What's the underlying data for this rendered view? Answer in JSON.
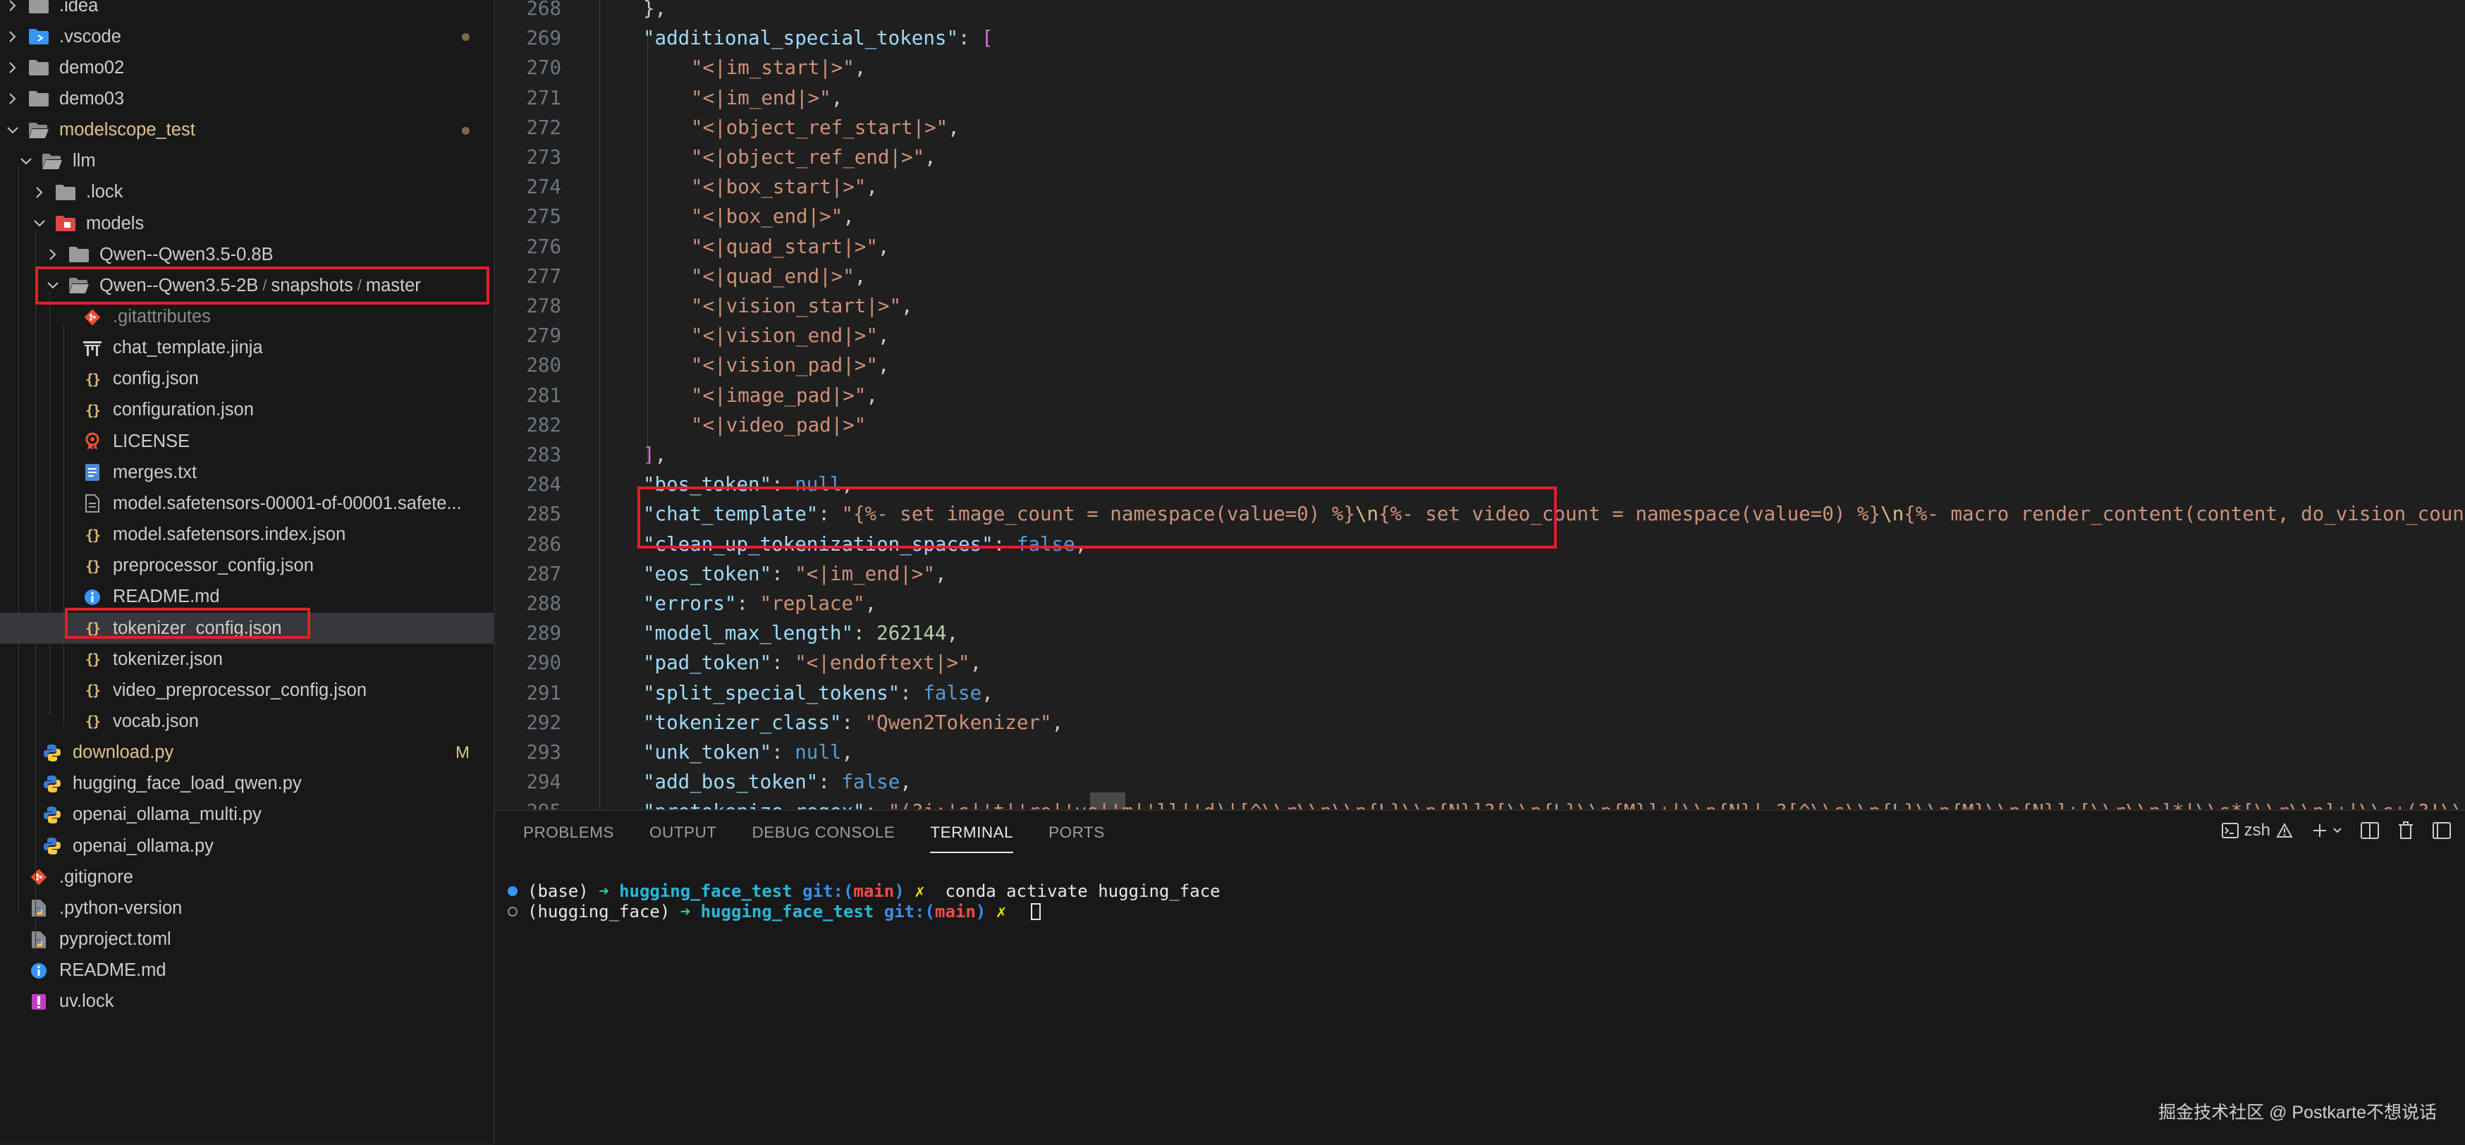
{
  "colors": {
    "background": "#1f1f1f",
    "sidebar_bg": "#181818",
    "highlight_red": "#e0202a",
    "modified_yellow": "#e2c08d",
    "json_key": "#9cdcfe",
    "json_string": "#ce9178"
  },
  "explorer": {
    "items": [
      {
        "label": ".idea",
        "icon": "folder-idea-icon",
        "depth": 0,
        "chevron": "right"
      },
      {
        "label": ".vscode",
        "icon": "folder-vscode-icon",
        "depth": 0,
        "chevron": "right",
        "status": "dot"
      },
      {
        "label": "demo02",
        "icon": "folder-icon",
        "depth": 0,
        "chevron": "right"
      },
      {
        "label": "demo03",
        "icon": "folder-icon",
        "depth": 0,
        "chevron": "right"
      },
      {
        "label": "modelscope_test",
        "icon": "folder-open-icon",
        "depth": 0,
        "chevron": "down",
        "status": "dot",
        "modified": true
      },
      {
        "label": "llm",
        "icon": "folder-open-icon",
        "depth": 1,
        "chevron": "down"
      },
      {
        "label": ".lock",
        "icon": "folder-icon",
        "depth": 2,
        "chevron": "right"
      },
      {
        "label": "models",
        "icon": "folder-models-icon",
        "depth": 2,
        "chevron": "down"
      },
      {
        "label": "Qwen--Qwen3.5-0.8B",
        "icon": "folder-icon",
        "depth": 3,
        "chevron": "right"
      },
      {
        "label": "Qwen--Qwen3.5-2B",
        "path_parts": [
          "snapshots",
          "master"
        ],
        "icon": "folder-open-icon",
        "depth": 3,
        "chevron": "down"
      },
      {
        "label": ".gitattributes",
        "icon": "git-icon",
        "depth": 4,
        "dim": true
      },
      {
        "label": "chat_template.jinja",
        "icon": "jinja-icon",
        "depth": 4
      },
      {
        "label": "config.json",
        "icon": "json-icon",
        "depth": 4
      },
      {
        "label": "configuration.json",
        "icon": "json-icon",
        "depth": 4
      },
      {
        "label": "LICENSE",
        "icon": "license-icon",
        "depth": 4
      },
      {
        "label": "merges.txt",
        "icon": "text-file-icon",
        "depth": 4
      },
      {
        "label": "model.safetensors-00001-of-00001.safete...",
        "icon": "file-icon",
        "depth": 4
      },
      {
        "label": "model.safetensors.index.json",
        "icon": "json-icon",
        "depth": 4
      },
      {
        "label": "preprocessor_config.json",
        "icon": "json-icon",
        "depth": 4
      },
      {
        "label": "README.md",
        "icon": "info-icon",
        "depth": 4
      },
      {
        "label": "tokenizer_config.json",
        "icon": "json-icon",
        "depth": 4,
        "selected": true
      },
      {
        "label": "tokenizer.json",
        "icon": "json-icon",
        "depth": 4
      },
      {
        "label": "video_preprocessor_config.json",
        "icon": "json-icon",
        "depth": 4
      },
      {
        "label": "vocab.json",
        "icon": "json-icon",
        "depth": 4
      },
      {
        "label": "download.py",
        "icon": "python-icon",
        "depth": 1,
        "modified": true,
        "status": "M"
      },
      {
        "label": "hugging_face_load_qwen.py",
        "icon": "python-icon",
        "depth": 1
      },
      {
        "label": "openai_ollama_multi.py",
        "icon": "python-icon",
        "depth": 1
      },
      {
        "label": "openai_ollama.py",
        "icon": "python-icon",
        "depth": 1
      },
      {
        "label": ".gitignore",
        "icon": "git-icon",
        "depth": 0
      },
      {
        "label": ".python-version",
        "icon": "python-version-icon",
        "depth": 0
      },
      {
        "label": "pyproject.toml",
        "icon": "toml-icon",
        "depth": 0
      },
      {
        "label": "README.md",
        "icon": "info-icon",
        "depth": 0
      },
      {
        "label": "uv.lock",
        "icon": "lock-icon",
        "depth": 0
      }
    ]
  },
  "editor": {
    "lines": [
      {
        "n": "268",
        "indent": 1,
        "tokens": [
          [
            "p",
            "},"
          ]
        ]
      },
      {
        "n": "269",
        "indent": 1,
        "tokens": [
          [
            "k",
            "\"additional_special_tokens\""
          ],
          [
            "p",
            ": "
          ],
          [
            "br",
            "["
          ]
        ]
      },
      {
        "n": "270",
        "indent": 2,
        "tokens": [
          [
            "s",
            "\"<|im_start|>\""
          ],
          [
            "p",
            ","
          ]
        ]
      },
      {
        "n": "271",
        "indent": 2,
        "tokens": [
          [
            "s",
            "\"<|im_end|>\""
          ],
          [
            "p",
            ","
          ]
        ]
      },
      {
        "n": "272",
        "indent": 2,
        "tokens": [
          [
            "s",
            "\"<|object_ref_start|>\""
          ],
          [
            "p",
            ","
          ]
        ]
      },
      {
        "n": "273",
        "indent": 2,
        "tokens": [
          [
            "s",
            "\"<|object_ref_end|>\""
          ],
          [
            "p",
            ","
          ]
        ]
      },
      {
        "n": "274",
        "indent": 2,
        "tokens": [
          [
            "s",
            "\"<|box_start|>\""
          ],
          [
            "p",
            ","
          ]
        ]
      },
      {
        "n": "275",
        "indent": 2,
        "tokens": [
          [
            "s",
            "\"<|box_end|>\""
          ],
          [
            "p",
            ","
          ]
        ]
      },
      {
        "n": "276",
        "indent": 2,
        "tokens": [
          [
            "s",
            "\"<|quad_start|>\""
          ],
          [
            "p",
            ","
          ]
        ]
      },
      {
        "n": "277",
        "indent": 2,
        "tokens": [
          [
            "s",
            "\"<|quad_end|>\""
          ],
          [
            "p",
            ","
          ]
        ]
      },
      {
        "n": "278",
        "indent": 2,
        "tokens": [
          [
            "s",
            "\"<|vision_start|>\""
          ],
          [
            "p",
            ","
          ]
        ]
      },
      {
        "n": "279",
        "indent": 2,
        "tokens": [
          [
            "s",
            "\"<|vision_end|>\""
          ],
          [
            "p",
            ","
          ]
        ]
      },
      {
        "n": "280",
        "indent": 2,
        "tokens": [
          [
            "s",
            "\"<|vision_pad|>\""
          ],
          [
            "p",
            ","
          ]
        ]
      },
      {
        "n": "281",
        "indent": 2,
        "tokens": [
          [
            "s",
            "\"<|image_pad|>\""
          ],
          [
            "p",
            ","
          ]
        ]
      },
      {
        "n": "282",
        "indent": 2,
        "tokens": [
          [
            "s",
            "\"<|video_pad|>\""
          ]
        ]
      },
      {
        "n": "283",
        "indent": 1,
        "tokens": [
          [
            "br",
            "]"
          ],
          [
            "p",
            ","
          ]
        ]
      },
      {
        "n": "284",
        "indent": 1,
        "tokens": [
          [
            "k",
            "\"bos_token\""
          ],
          [
            "p",
            ": "
          ],
          [
            "b",
            "null"
          ],
          [
            "p",
            ","
          ]
        ]
      },
      {
        "n": "285",
        "indent": 1,
        "tokens": [
          [
            "k",
            "\"chat_template\""
          ],
          [
            "p",
            ": "
          ],
          [
            "s",
            "\"{%- set image_count = namespace(value=0) %}"
          ],
          [
            "e",
            "\\n"
          ],
          [
            "s",
            "{%- set video_count = namespace(value=0) %}"
          ],
          [
            "e",
            "\\n"
          ],
          [
            "s",
            "{%- macro render_content(content, do_vision_count) %}"
          ]
        ]
      },
      {
        "n": "286",
        "indent": 1,
        "tokens": [
          [
            "k",
            "\"clean_up_tokenization_spaces\""
          ],
          [
            "p",
            ": "
          ],
          [
            "b",
            "false"
          ],
          [
            "p",
            ","
          ]
        ]
      },
      {
        "n": "287",
        "indent": 1,
        "tokens": [
          [
            "k",
            "\"eos_token\""
          ],
          [
            "p",
            ": "
          ],
          [
            "s",
            "\"<|im_end|>\""
          ],
          [
            "p",
            ","
          ]
        ]
      },
      {
        "n": "288",
        "indent": 1,
        "tokens": [
          [
            "k",
            "\"errors\""
          ],
          [
            "p",
            ": "
          ],
          [
            "s",
            "\"replace\""
          ],
          [
            "p",
            ","
          ]
        ]
      },
      {
        "n": "289",
        "indent": 1,
        "tokens": [
          [
            "k",
            "\"model_max_length\""
          ],
          [
            "p",
            ": "
          ],
          [
            "n",
            "262144"
          ],
          [
            "p",
            ","
          ]
        ]
      },
      {
        "n": "290",
        "indent": 1,
        "tokens": [
          [
            "k",
            "\"pad_token\""
          ],
          [
            "p",
            ": "
          ],
          [
            "s",
            "\"<|endoftext|>\""
          ],
          [
            "p",
            ","
          ]
        ]
      },
      {
        "n": "291",
        "indent": 1,
        "tokens": [
          [
            "k",
            "\"split_special_tokens\""
          ],
          [
            "p",
            ": "
          ],
          [
            "b",
            "false"
          ],
          [
            "p",
            ","
          ]
        ]
      },
      {
        "n": "292",
        "indent": 1,
        "tokens": [
          [
            "k",
            "\"tokenizer_class\""
          ],
          [
            "p",
            ": "
          ],
          [
            "s",
            "\"Qwen2Tokenizer\""
          ],
          [
            "p",
            ","
          ]
        ]
      },
      {
        "n": "293",
        "indent": 1,
        "tokens": [
          [
            "k",
            "\"unk_token\""
          ],
          [
            "p",
            ": "
          ],
          [
            "b",
            "null"
          ],
          [
            "p",
            ","
          ]
        ]
      },
      {
        "n": "294",
        "indent": 1,
        "tokens": [
          [
            "k",
            "\"add_bos_token\""
          ],
          [
            "p",
            ": "
          ],
          [
            "b",
            "false"
          ],
          [
            "p",
            ","
          ]
        ]
      },
      {
        "n": "295",
        "indent": 1,
        "tokens": [
          [
            "k",
            "\"pretokenize_regex\""
          ],
          [
            "p",
            ": "
          ],
          [
            "s",
            "\"(?i:'s|'t|'re|'ve|'m|'ll|'d)|[^\\\\r\\\\n\\\\p{L}\\\\p{N}]?[\\\\p{L}\\\\p{M}]+|\\\\p{N}| ?[^\\\\s\\\\p{L}\\\\p{M}\\\\p{N}]+[\\\\r\\\\n]*|\\\\s*[\\\\r\\\\n]+|\\\\s+(?!\\\\S)|\\\\s+\""
          ]
        ]
      }
    ]
  },
  "panel": {
    "tabs": [
      "PROBLEMS",
      "OUTPUT",
      "DEBUG CONSOLE",
      "TERMINAL",
      "PORTS"
    ],
    "active_tab": "TERMINAL",
    "terminal_name": "zsh",
    "terminal": [
      {
        "env": "(base)",
        "arrow": "➜",
        "dir": "hugging_face_test",
        "git_label": "git:(",
        "branch": "main",
        "git_close": ")",
        "dirty": "✗",
        "cmd": "conda activate hugging_face",
        "status": "done"
      },
      {
        "env": "(hugging_face)",
        "arrow": "➜",
        "dir": "hugging_face_test",
        "git_label": "git:(",
        "branch": "main",
        "git_close": ")",
        "dirty": "✗",
        "cmd": "",
        "status": "pending"
      }
    ]
  },
  "watermark": "掘金技术社区 @ Postkarte不想说话"
}
